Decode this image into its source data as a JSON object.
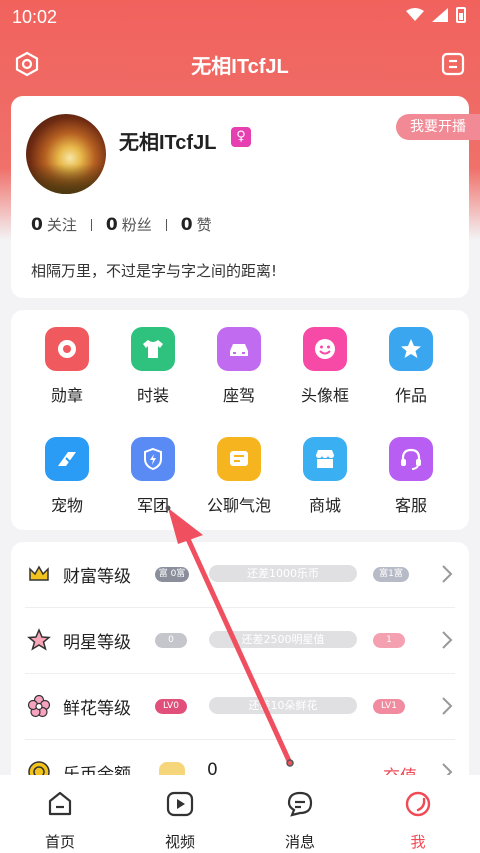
{
  "status_bar": {
    "time": "10:02"
  },
  "header": {
    "title": "无相ITcfJL"
  },
  "profile": {
    "nickname": "无相ITcfJL",
    "gender_badge": "♀",
    "live_button": "我要开播",
    "stats": [
      {
        "count": "0",
        "label": "关注"
      },
      {
        "count": "0",
        "label": "粉丝"
      },
      {
        "count": "0",
        "label": "赞"
      }
    ],
    "bio": "相隔万里，不过是字与字之间的距离!"
  },
  "features": [
    {
      "label": "勋章",
      "icon": "medal-icon",
      "color": "#f05a5e"
    },
    {
      "label": "时装",
      "icon": "shirt-icon",
      "color": "#2ec27e"
    },
    {
      "label": "座驾",
      "icon": "car-icon",
      "color": "#c06bf0"
    },
    {
      "label": "头像框",
      "icon": "smile-icon",
      "color": "#f74aa6"
    },
    {
      "label": "作品",
      "icon": "star-icon",
      "color": "#3aa6f0"
    },
    {
      "label": "宠物",
      "icon": "pet-icon",
      "color": "#2a9cf5"
    },
    {
      "label": "军团",
      "icon": "shield-icon",
      "color": "#5a8bf5"
    },
    {
      "label": "公聊气泡",
      "icon": "chat-bubble-icon",
      "color": "#f6b51e"
    },
    {
      "label": "商城",
      "icon": "shop-icon",
      "color": "#3ab0f2"
    },
    {
      "label": "客服",
      "icon": "headset-icon",
      "color": "#b95ef2"
    }
  ],
  "levels": [
    {
      "title": "财富等级",
      "icon": "crown-icon",
      "left_badge": "富 0富",
      "progress_text": "还差1000乐币",
      "right_badge": "富1富"
    },
    {
      "title": "明星等级",
      "icon": "star-outline-icon",
      "left_badge": "0",
      "progress_text": "还差2500明星值",
      "right_badge": "1"
    },
    {
      "title": "鲜花等级",
      "icon": "flower-icon",
      "left_badge": "LV0",
      "progress_text": "还差10朵鲜花",
      "right_badge": "LV1"
    },
    {
      "title": "乐币余额",
      "icon": "coin-icon",
      "balance": "0",
      "action": "充值"
    }
  ],
  "bottom_nav": [
    {
      "label": "首页",
      "icon": "home-icon",
      "active": false
    },
    {
      "label": "视频",
      "icon": "video-icon",
      "active": false
    },
    {
      "label": "消息",
      "icon": "message-icon",
      "active": false
    },
    {
      "label": "我",
      "icon": "profile-icon",
      "active": true
    }
  ],
  "colors": {
    "accent": "#f04a55",
    "header": "#f1625d",
    "arrow": "#ef4f5f"
  }
}
